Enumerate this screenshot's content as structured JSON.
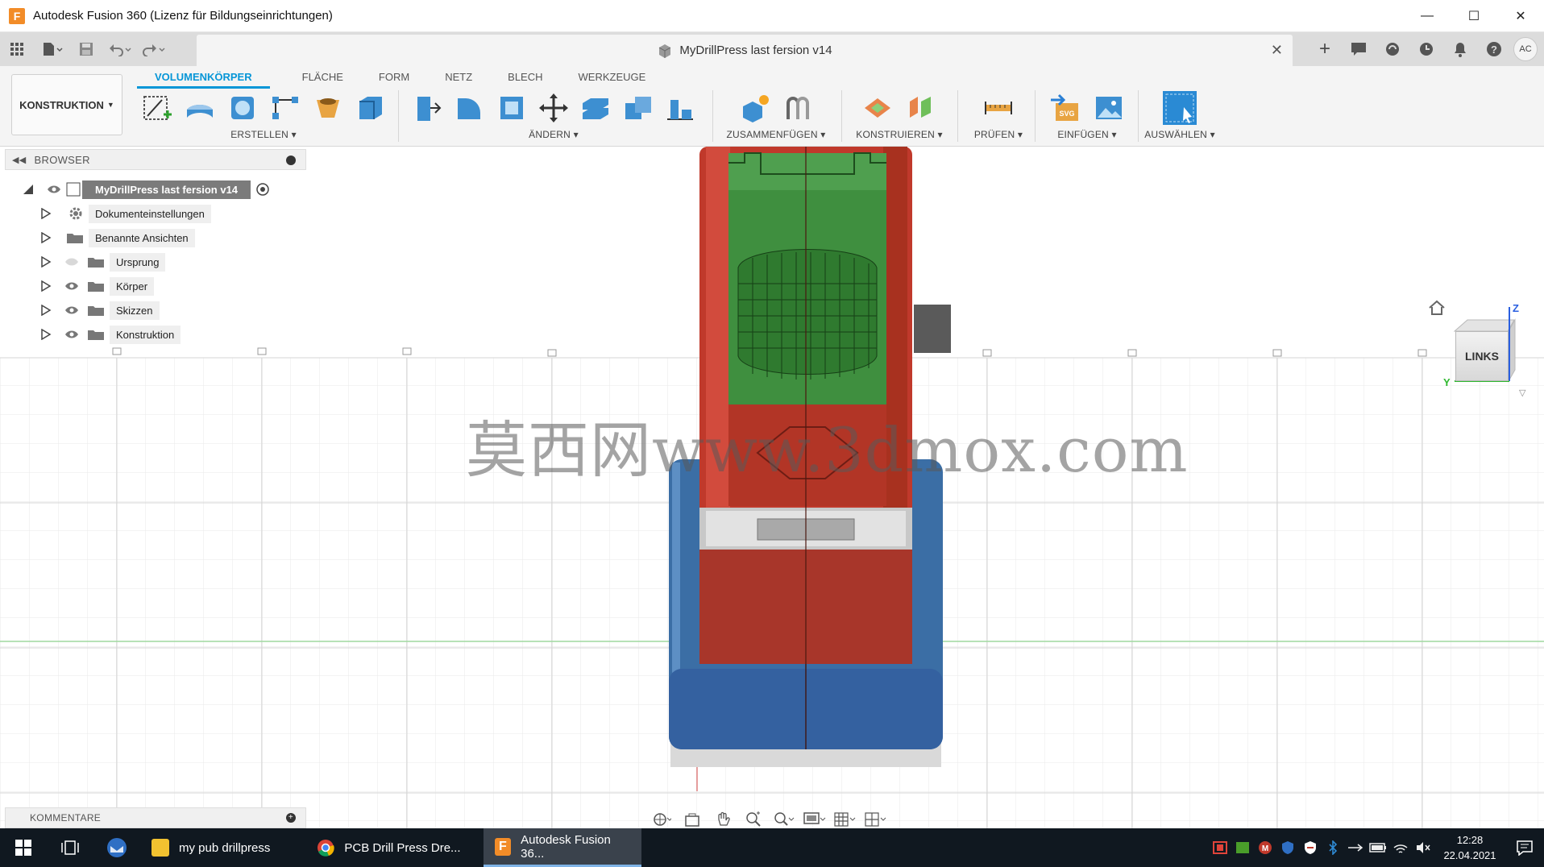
{
  "window": {
    "title": "Autodesk Fusion 360 (Lizenz für Bildungseinrichtungen)",
    "controls": [
      "minimize",
      "maximize",
      "close"
    ]
  },
  "document": {
    "title": "MyDrillPress last fersion v14"
  },
  "user": {
    "initials": "AC"
  },
  "ribbon": {
    "workspace": "KONSTRUKTION",
    "tabs": [
      "VOLUMENKÖRPER",
      "FLÄCHE",
      "FORM",
      "NETZ",
      "BLECH",
      "WERKZEUGE"
    ],
    "active_tab": "VOLUMENKÖRPER",
    "groups": {
      "erstellen": "ERSTELLEN",
      "aendern": "ÄNDERN",
      "zusammenfuegen": "ZUSAMMENFÜGEN",
      "konstruieren": "KONSTRUIEREN",
      "pruefen": "PRÜFEN",
      "einfuegen": "EINFÜGEN",
      "auswaehlen": "AUSWÄHLEN"
    }
  },
  "browser": {
    "title": "BROWSER",
    "root": "MyDrillPress last fersion v14",
    "items": [
      {
        "label": "Dokumenteinstellungen",
        "icon": "gear-icon"
      },
      {
        "label": "Benannte Ansichten",
        "icon": "folder-icon"
      },
      {
        "label": "Ursprung",
        "icon": "folder-icon",
        "hidden": true
      },
      {
        "label": "Körper",
        "icon": "folder-icon"
      },
      {
        "label": "Skizzen",
        "icon": "folder-icon"
      },
      {
        "label": "Konstruktion",
        "icon": "folder-icon"
      }
    ]
  },
  "comments": {
    "title": "KOMMENTARE"
  },
  "viewcube": {
    "face": "LINKS",
    "axis_z": "Z",
    "axis_y": "Y"
  },
  "watermark": "莫西网www.3dmox.com",
  "taskbar": {
    "apps": [
      {
        "label": "my pub drillpress",
        "icon": "folder-icon"
      },
      {
        "label": "PCB Drill Press Dre...",
        "icon": "chrome-icon"
      },
      {
        "label": "Autodesk Fusion 36...",
        "icon": "fusion-icon",
        "active": true
      }
    ],
    "time": "12:28",
    "date": "22.04.2021"
  },
  "colors": {
    "accent": "#0696d7",
    "model_red": "#c0392b",
    "model_green": "#3f8f3f",
    "model_blue": "#3b6ea5"
  }
}
